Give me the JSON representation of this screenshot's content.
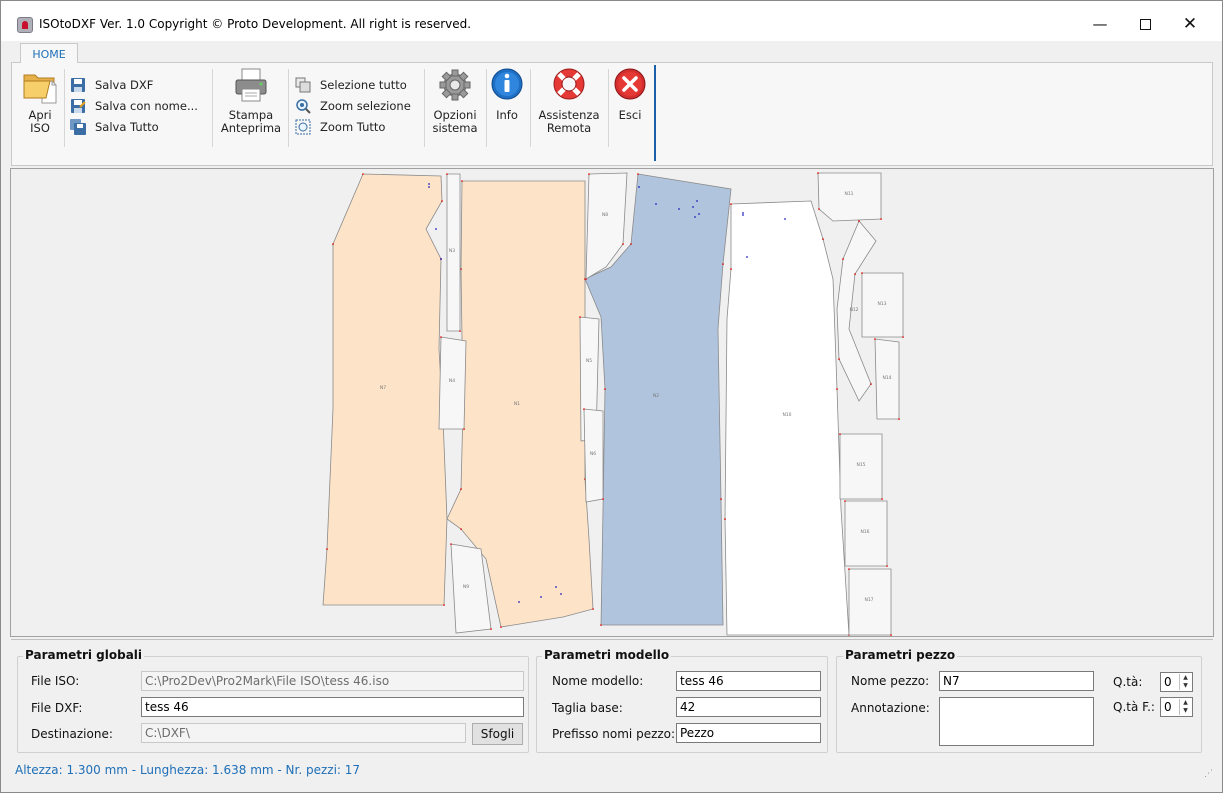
{
  "window": {
    "title": "ISOtoDXF Ver. 1.0 Copyright © Proto Development. All right is reserved.",
    "min_symbol": "—",
    "close_symbol": "✕"
  },
  "ribbon": {
    "tab": "HOME",
    "apri": [
      "Apri",
      "ISO"
    ],
    "salva_dxf": "Salva DXF",
    "salva_con_nome": "Salva con nome...",
    "salva_tutto": "Salva Tutto",
    "stampa": [
      "Stampa",
      "Anteprima"
    ],
    "selezione_tutto": "Selezione tutto",
    "zoom_selezione": "Zoom selezione",
    "zoom_tutto": "Zoom Tutto",
    "opzioni": [
      "Opzioni",
      "sistema"
    ],
    "info": "Info",
    "assistenza": [
      "Assistenza",
      "Remota"
    ],
    "esci": "Esci"
  },
  "canvas": {
    "pieces": [
      {
        "label": "N7",
        "fill": "#fde3c7"
      },
      {
        "label": "N1",
        "fill": "#fde3c7"
      },
      {
        "label": "N2",
        "fill": "#b0c4de"
      },
      {
        "label": "N10",
        "fill": "#ffffff"
      },
      {
        "label": "N3",
        "fill": "#f7f7f7"
      },
      {
        "label": "N4",
        "fill": "#f7f7f7"
      },
      {
        "label": "N5",
        "fill": "#f7f7f7"
      },
      {
        "label": "N6",
        "fill": "#f7f7f7"
      },
      {
        "label": "N8",
        "fill": "#f7f7f7"
      },
      {
        "label": "N9",
        "fill": "#f7f7f7"
      },
      {
        "label": "N11",
        "fill": "#f7f7f7"
      },
      {
        "label": "N12",
        "fill": "#f7f7f7"
      },
      {
        "label": "N13",
        "fill": "#f7f7f7"
      },
      {
        "label": "N14",
        "fill": "#f7f7f7"
      },
      {
        "label": "N15",
        "fill": "#f7f7f7"
      },
      {
        "label": "N16",
        "fill": "#f7f7f7"
      },
      {
        "label": "N17",
        "fill": "#f7f7f7"
      }
    ],
    "notch_color": "#e0201a",
    "point_color": "#2020c0"
  },
  "globali": {
    "title": "Parametri globali",
    "file_iso_label": "File ISO:",
    "file_iso_value": "C:\\Pro2Dev\\Pro2Mark\\File ISO\\tess 46.iso",
    "file_dxf_label": "File DXF:",
    "file_dxf_value": "tess 46",
    "dest_label": "Destinazione:",
    "dest_value": "C:\\DXF\\",
    "sfogli": "Sfogli"
  },
  "modello": {
    "title": "Parametri modello",
    "nome_label": "Nome modello:",
    "nome_value": "tess 46",
    "taglia_label": "Taglia base:",
    "taglia_value": "42",
    "prefisso_label": "Prefisso nomi pezzo:",
    "prefisso_value": "Pezzo"
  },
  "pezzo": {
    "title": "Parametri pezzo",
    "nome_label": "Nome pezzo:",
    "nome_value": "N7",
    "annot_label": "Annotazione:",
    "annot_value": "",
    "qta_label": "Q.tà:",
    "qta_value": "0",
    "qtaf_label": "Q.tà F.:",
    "qtaf_value": "0"
  },
  "status": "Altezza: 1.300 mm - Lunghezza: 1.638 mm - Nr. pezzi: 17"
}
